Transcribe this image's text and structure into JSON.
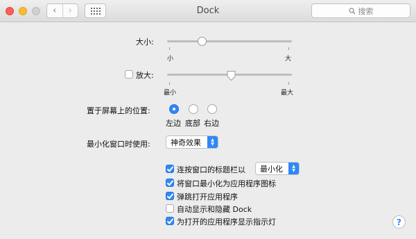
{
  "window": {
    "title": "Dock",
    "search_placeholder": "搜索"
  },
  "size": {
    "label": "大小:",
    "min_label": "小",
    "max_label": "大",
    "level": 0.28
  },
  "magnification": {
    "label": "放大:",
    "checked": false,
    "min_label": "最小",
    "max_label": "最大",
    "level": 0.52
  },
  "position": {
    "label": "置于屏幕上的位置:",
    "options": [
      "左边",
      "底部",
      "右边"
    ],
    "selected": "左边"
  },
  "minimize_effect": {
    "label": "最小化窗口时使用:",
    "value": "神奇效果"
  },
  "options": [
    {
      "label": "连按窗口的标题栏以",
      "checked": true,
      "select_value": "最小化"
    },
    {
      "label": "将窗口最小化为应用程序图标",
      "checked": true
    },
    {
      "label": "弹跳打开应用程序",
      "checked": true
    },
    {
      "label": "自动显示和隐藏 Dock",
      "checked": false
    },
    {
      "label": "为打开的应用程序显示指示灯",
      "checked": true
    }
  ],
  "help": {
    "symbol": "?"
  },
  "colors": {
    "accent": "#2f88f6",
    "close": "#fc5f57",
    "minimize": "#fdbc2e"
  }
}
